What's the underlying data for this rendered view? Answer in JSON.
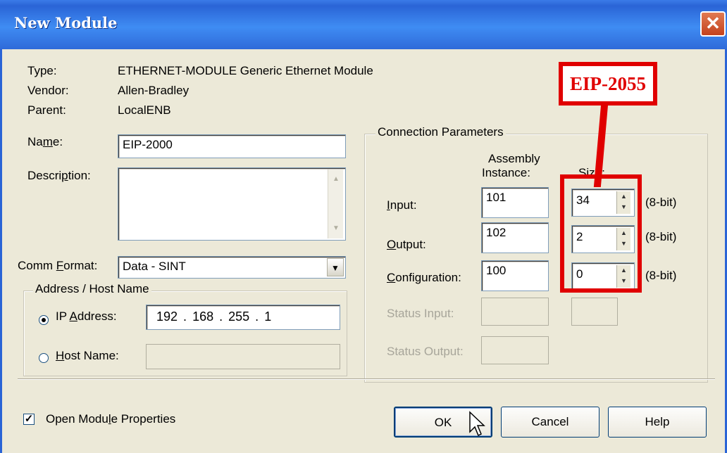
{
  "window": {
    "title": "New Module",
    "close_glyph": "✕"
  },
  "info": {
    "type_label": "Type:",
    "type_value": "ETHERNET-MODULE Generic Ethernet Module",
    "vendor_label": "Vendor:",
    "vendor_value": "Allen-Bradley",
    "parent_label": "Parent:",
    "parent_value": "LocalENB"
  },
  "name": {
    "label_pre": "Na",
    "label_u": "m",
    "label_post": "e:",
    "value": "EIP-2000"
  },
  "description": {
    "label_pre": "Descri",
    "label_u": "p",
    "label_post": "tion:",
    "value": ""
  },
  "comm_format": {
    "label_pre": "Comm ",
    "label_u": "F",
    "label_post": "ormat:",
    "value": "Data - SINT"
  },
  "address": {
    "group_label": "Address / Host Name",
    "ip_label_pre": "IP ",
    "ip_label_u": "A",
    "ip_label_post": "ddress:",
    "ip_octets": [
      "192",
      "168",
      "255",
      "1"
    ],
    "ip_selected": true,
    "host_label_u": "H",
    "host_label_post": "ost Name:",
    "host_value": ""
  },
  "connection": {
    "group_label": "Connection Parameters",
    "col_assembly": "Assembly",
    "col_instance": "Instance:",
    "col_size": "Size:",
    "rows": [
      {
        "label_u": "I",
        "label_post": "nput:",
        "instance": "101",
        "size": "34",
        "unit": "(8-bit)"
      },
      {
        "label_u": "O",
        "label_post": "utput:",
        "instance": "102",
        "size": "2",
        "unit": "(8-bit)"
      },
      {
        "label_u": "C",
        "label_post": "onfiguration:",
        "instance": "100",
        "size": "0",
        "unit": "(8-bit)"
      }
    ],
    "status_input_label": "Status Input:",
    "status_output_label": "Status Output:"
  },
  "open_props": {
    "label_pre": "Open Modu",
    "label_u": "l",
    "label_post": "e Properties",
    "checked": true
  },
  "buttons": {
    "ok": "OK",
    "cancel": "Cancel",
    "help": "Help"
  },
  "annotation": {
    "text": "EIP-2055",
    "color": "#e00000"
  },
  "icons": {
    "dropdown": "chevron-down-icon",
    "spin": "spin-arrows-icon",
    "cursor": "mouse-pointer-icon"
  }
}
